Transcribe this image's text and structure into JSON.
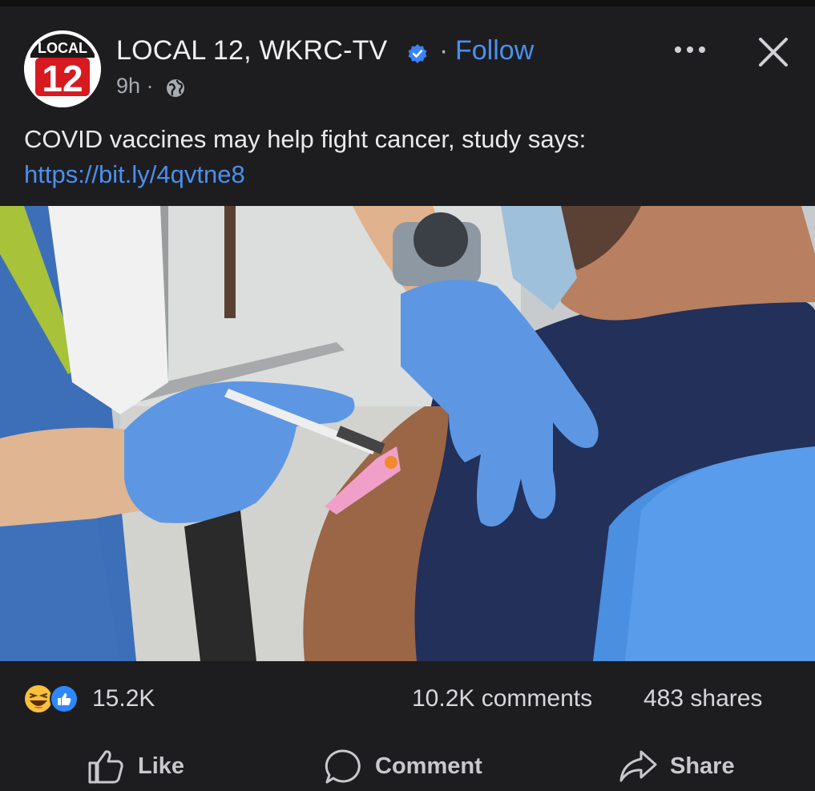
{
  "post": {
    "page_name": "LOCAL 12, WKRC-TV",
    "separator": "·",
    "follow_label": "Follow",
    "time": "9h ·",
    "avatar": {
      "logo_text": "LOCAL",
      "logo_number": "12",
      "brand_color": "#d71920"
    },
    "caption_text": "COVID vaccines may help fight cancer, study says: ",
    "caption_link": "https://bit.ly/4qvtne8",
    "link_color": "#4a90f0",
    "icons": {
      "verified": "verified-badge-icon",
      "privacy": "globe-icon",
      "more": "more-options-icon",
      "close": "close-icon"
    }
  },
  "stats": {
    "reaction_icons": [
      "haha-emoji-icon",
      "like-reaction-icon"
    ],
    "reaction_count": "15.2K",
    "comments": "10.2K comments",
    "shares": "483 shares"
  },
  "actions": {
    "like": "Like",
    "comment": "Comment",
    "share": "Share"
  }
}
